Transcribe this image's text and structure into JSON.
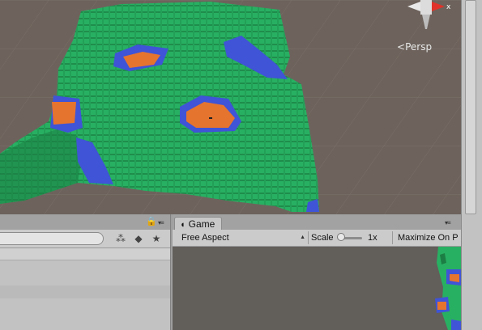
{
  "scene_view": {
    "projection_label": "Persp",
    "colors": {
      "background": "#6d635c",
      "terrain_green": "#25a85c",
      "water_blue": "#3f54d6",
      "sand_orange": "#e5742f"
    }
  },
  "left_panel": {
    "search_placeholder": "",
    "icons": [
      "lock-icon",
      "menu-icon",
      "filter-icon",
      "tag-icon",
      "star-icon"
    ]
  },
  "game_panel": {
    "tab_label": "Game",
    "aspect_dropdown": "Free Aspect",
    "scale_label": "Scale",
    "scale_value": "1x",
    "scale_level": 0,
    "maximize_button": "Maximize On P"
  }
}
